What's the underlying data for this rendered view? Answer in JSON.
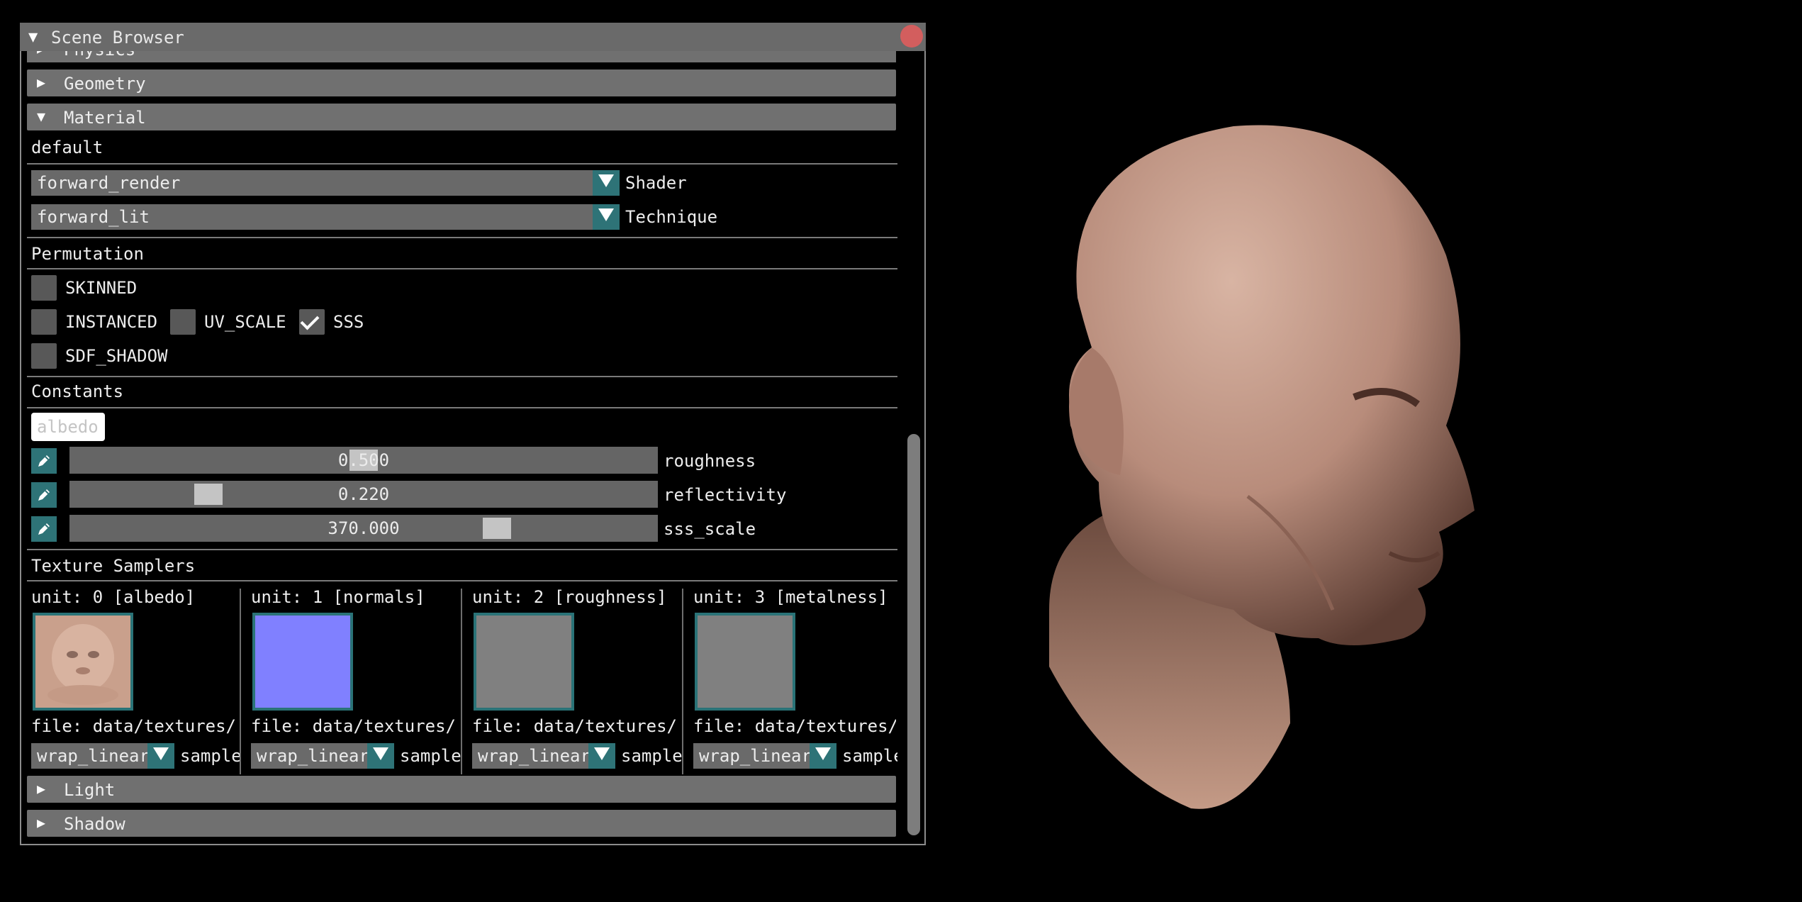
{
  "window": {
    "title": "Scene Browser"
  },
  "sections": {
    "physics": "Physics",
    "geometry": "Geometry",
    "material": "Material",
    "light": "Light",
    "shadow": "Shadow"
  },
  "material": {
    "name": "default",
    "shader": {
      "value": "forward_render",
      "label": "Shader"
    },
    "technique": {
      "value": "forward_lit",
      "label": "Technique"
    },
    "permutation_label": "Permutation",
    "permutations": [
      {
        "label": "SKINNED",
        "checked": false
      },
      {
        "label": "INSTANCED",
        "checked": false
      },
      {
        "label": "UV_SCALE",
        "checked": false
      },
      {
        "label": "SSS",
        "checked": true
      },
      {
        "label": "SDF_SHADOW",
        "checked": false
      }
    ],
    "constants_label": "Constants",
    "albedo_button": "albedo",
    "constants": [
      {
        "label": "roughness",
        "value": "0.500",
        "fraction": 0.5
      },
      {
        "label": "reflectivity",
        "value": "0.220",
        "fraction": 0.22
      },
      {
        "label": "sss_scale",
        "value": "370.000",
        "fraction": 0.74
      }
    ],
    "texture_samplers_label": "Texture Samplers",
    "samplers": [
      {
        "unit": "unit: 0 [albedo]",
        "file": "file: data/textures/",
        "wrap": "wrap_linear",
        "sampler": "sampler",
        "color": "#c9a08c"
      },
      {
        "unit": "unit: 1 [normals]",
        "file": "file: data/textures/",
        "wrap": "wrap_linear",
        "sampler": "sampler",
        "color": "#8080ff"
      },
      {
        "unit": "unit: 2 [roughness]",
        "file": "file: data/textures/",
        "wrap": "wrap_linear",
        "sampler": "sampler",
        "color": "#808080"
      },
      {
        "unit": "unit: 3 [metalness]",
        "file": "file: data/textures/",
        "wrap": "wrap_linear",
        "sampler": "sampler",
        "color": "#808080"
      }
    ]
  },
  "colors": {
    "accent": "#2e7377",
    "panel": "#707070",
    "close": "#d35e5e"
  },
  "viewport": {
    "subject": "head-render"
  }
}
